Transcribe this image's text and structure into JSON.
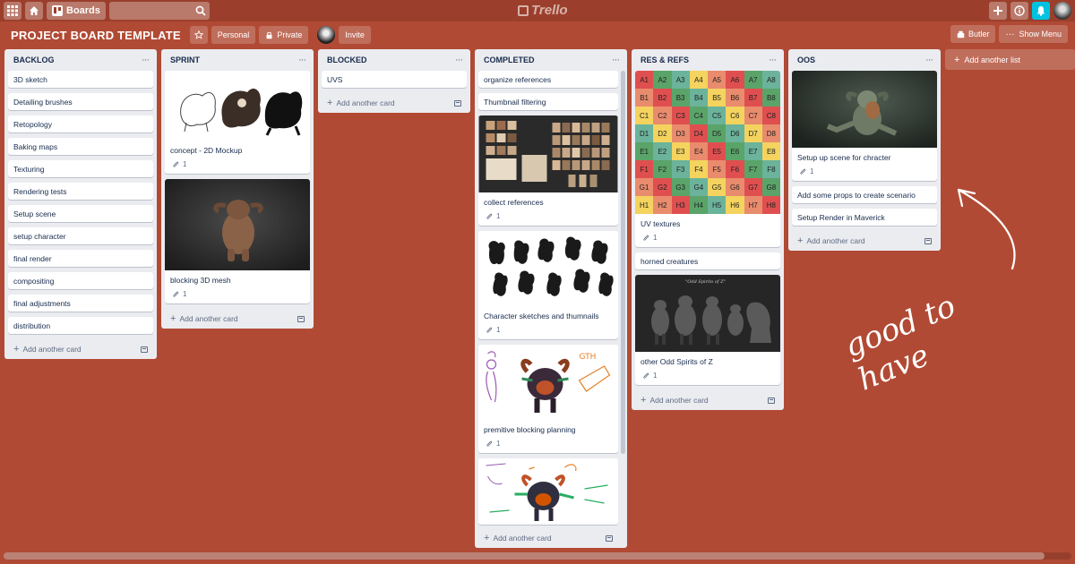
{
  "app": {
    "logo": "Trello"
  },
  "topbar": {
    "boards_label": "Boards"
  },
  "board": {
    "title": "PROJECT BOARD TEMPLATE",
    "visibility_team": "Personal",
    "visibility": "Private",
    "invite_label": "Invite",
    "butler_label": "Butler",
    "show_menu_label": "Show Menu"
  },
  "add_card_label": "Add another card",
  "add_list_label": "Add another list",
  "lists": [
    {
      "title": "BACKLOG",
      "cards": [
        "3D sketch",
        "Detailing brushes",
        "Retopology",
        "Baking maps",
        "Texturing",
        "Rendering tests",
        "Setup scene",
        "setup character",
        "final render",
        "compositing",
        "final adjustments",
        "distribution"
      ]
    },
    {
      "title": "SPRINT",
      "cards": [
        {
          "text": "concept - 2D Mockup",
          "attachments": "1"
        },
        {
          "text": "blocking 3D mesh",
          "attachments": "1"
        }
      ]
    },
    {
      "title": "BLOCKED",
      "cards": [
        "UVS"
      ]
    },
    {
      "title": "COMPLETED",
      "cards": [
        {
          "text": "organize references"
        },
        {
          "text": "Thumbnail filtering"
        },
        {
          "text": "collect references",
          "attachments": "1"
        },
        {
          "text": "Character sketches and thumnails",
          "attachments": "1"
        },
        {
          "text": "premitive blocking planning",
          "attachments": "1"
        }
      ]
    },
    {
      "title": "RES & REFS",
      "cards": [
        {
          "text": "UV textures",
          "attachments": "1"
        },
        {
          "text": "horned creatures"
        },
        {
          "text": "other Odd Spirits of Z",
          "attachments": "1"
        }
      ],
      "uv_labels": [
        [
          "A1",
          "A2",
          "A3",
          "A4",
          "A5",
          "A6",
          "A7",
          "A8"
        ],
        [
          "B1",
          "B2",
          "B3",
          "B4",
          "B5",
          "B6",
          "B7",
          "B8"
        ],
        [
          "C1",
          "C2",
          "C3",
          "C4",
          "C5",
          "C6",
          "C7",
          "C8"
        ],
        [
          "D1",
          "D2",
          "D3",
          "D4",
          "D5",
          "D6",
          "D7",
          "D8"
        ],
        [
          "E1",
          "E2",
          "E3",
          "E4",
          "E5",
          "E6",
          "E7",
          "E8"
        ],
        [
          "F1",
          "F2",
          "F3",
          "F4",
          "F5",
          "F6",
          "F7",
          "F8"
        ],
        [
          "G1",
          "G2",
          "G3",
          "G4",
          "G5",
          "G6",
          "G7",
          "G8"
        ],
        [
          "H1",
          "H2",
          "H3",
          "H4",
          "H5",
          "H6",
          "H7",
          "H8"
        ]
      ],
      "uv_colors": [
        "#e04f4f",
        "#f4d35e",
        "#5aa469",
        "#e98b6d",
        "#6bb39b"
      ]
    },
    {
      "title": "OOS",
      "cards": [
        {
          "text": "Setup up scene for chracter",
          "attachments": "1"
        },
        {
          "text": "Add some props to create scenario"
        },
        {
          "text": "Setup Render in Maverick"
        }
      ]
    }
  ],
  "annotation": {
    "text": "good to have"
  },
  "colors": {
    "board_bg": "#b14a34",
    "topbar_bg": "#9b3f2c",
    "list_bg": "#ebecf0",
    "bell_bg": "#00c2e0"
  }
}
